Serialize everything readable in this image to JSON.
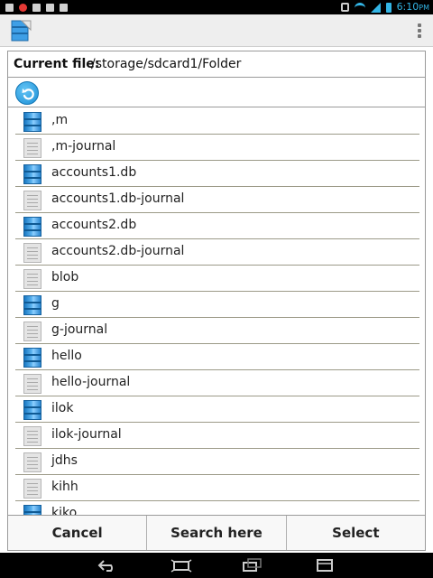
{
  "status_bar": {
    "time": "6:10",
    "ampm": "PM"
  },
  "current_file": {
    "label": "Current file:",
    "path": "/storage/sdcard1/Folder"
  },
  "files": [
    {
      "name": ",m",
      "icon": "database-icon"
    },
    {
      "name": ",m-journal",
      "icon": "document-icon"
    },
    {
      "name": "accounts1.db",
      "icon": "database-icon"
    },
    {
      "name": "accounts1.db-journal",
      "icon": "document-icon"
    },
    {
      "name": "accounts2.db",
      "icon": "database-icon"
    },
    {
      "name": "accounts2.db-journal",
      "icon": "document-icon"
    },
    {
      "name": "blob",
      "icon": "document-icon"
    },
    {
      "name": "g",
      "icon": "database-icon"
    },
    {
      "name": "g-journal",
      "icon": "document-icon"
    },
    {
      "name": "hello",
      "icon": "database-icon"
    },
    {
      "name": "hello-journal",
      "icon": "document-icon"
    },
    {
      "name": "ilok",
      "icon": "database-icon"
    },
    {
      "name": "ilok-journal",
      "icon": "document-icon"
    },
    {
      "name": "jdhs",
      "icon": "document-icon"
    },
    {
      "name": "kihh",
      "icon": "document-icon"
    },
    {
      "name": "kiko",
      "icon": "database-icon"
    }
  ],
  "buttons": {
    "cancel": "Cancel",
    "search_here": "Search here",
    "select": "Select"
  },
  "colors": {
    "accent": "#33b5e5",
    "database_icon": "#3a9ae0"
  }
}
